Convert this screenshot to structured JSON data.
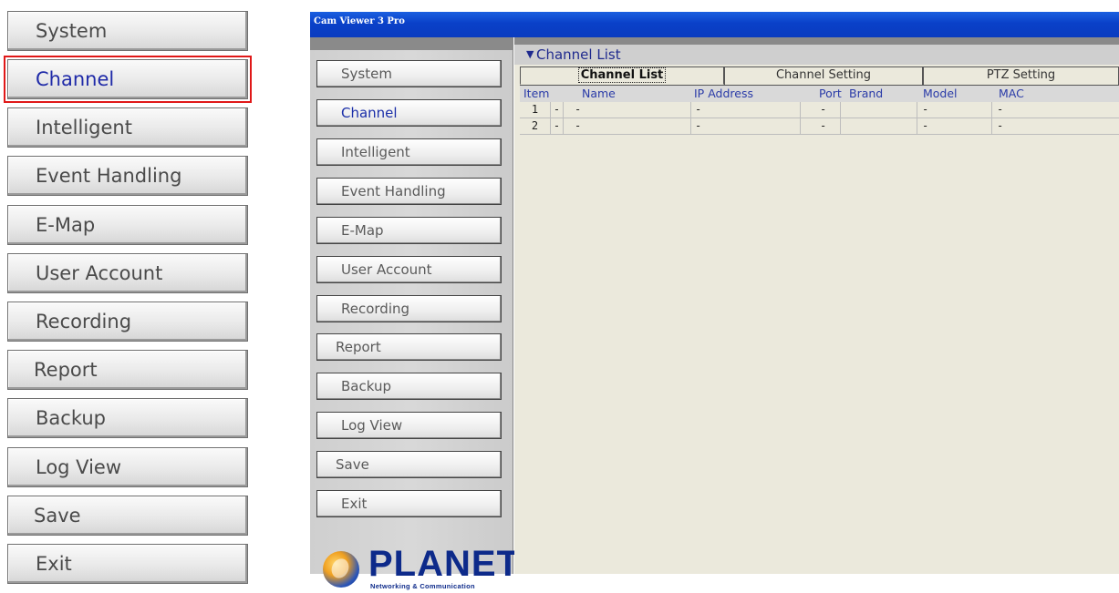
{
  "big_menu": {
    "items": [
      {
        "label": "System",
        "active": false
      },
      {
        "label": "Channel",
        "active": true
      },
      {
        "label": "Intelligent",
        "active": false
      },
      {
        "label": "Event Handling",
        "active": false
      },
      {
        "label": "E-Map",
        "active": false
      },
      {
        "label": "User Account",
        "active": false
      },
      {
        "label": "Recording",
        "active": false
      },
      {
        "label": "Report",
        "active": false
      },
      {
        "label": "Backup",
        "active": false
      },
      {
        "label": "Log View",
        "active": false
      },
      {
        "label": "Save",
        "active": false
      },
      {
        "label": "Exit",
        "active": false
      }
    ],
    "highlight_color": "#e01818"
  },
  "window": {
    "title": "Cam Viewer 3 Pro",
    "title_bar_color": "#0a40c8"
  },
  "sidebar": {
    "items": [
      {
        "label": "System",
        "active": false
      },
      {
        "label": "Channel",
        "active": true
      },
      {
        "label": "Intelligent",
        "active": false
      },
      {
        "label": "Event Handling",
        "active": false
      },
      {
        "label": "E-Map",
        "active": false
      },
      {
        "label": "User Account",
        "active": false
      },
      {
        "label": "Recording",
        "active": false
      },
      {
        "label": "Report",
        "active": false
      },
      {
        "label": "Backup",
        "active": false
      },
      {
        "label": "Log View",
        "active": false
      },
      {
        "label": "Save",
        "active": false
      },
      {
        "label": "Exit",
        "active": false
      }
    ],
    "logo": {
      "text": "PLANET",
      "subtext": "Networking & Communication",
      "icon": "planet-globe-icon"
    }
  },
  "panel": {
    "header_icon": "chevron-down-icon",
    "title": "Channel List",
    "tabs": [
      {
        "label": "Channel List",
        "active": true
      },
      {
        "label": "Channel Setting",
        "active": false
      },
      {
        "label": "PTZ Setting",
        "active": false
      }
    ],
    "table": {
      "columns": [
        "Item",
        "Name",
        "IP Address",
        "Port",
        "Brand",
        "Model",
        "MAC"
      ],
      "rows": [
        {
          "item": "1",
          "flag": "-",
          "name": "-",
          "ip": "-",
          "port": "-",
          "brand": "",
          "model": "-",
          "mac": "-"
        },
        {
          "item": "2",
          "flag": "-",
          "name": "-",
          "ip": "-",
          "port": "-",
          "brand": "",
          "model": "-",
          "mac": "-"
        }
      ]
    }
  }
}
